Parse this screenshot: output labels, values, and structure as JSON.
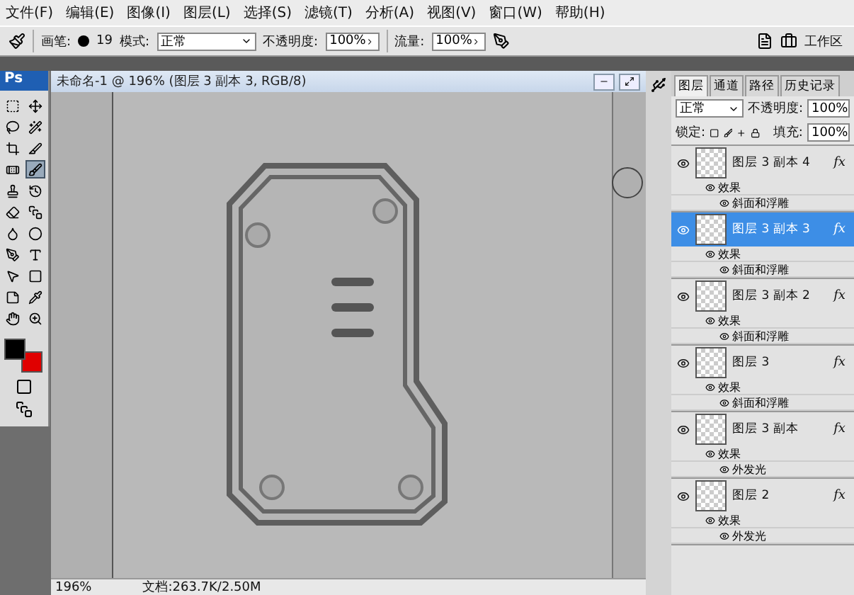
{
  "menu_bar": {
    "items": [
      "文件(F)",
      "编辑(E)",
      "图像(I)",
      "图层(L)",
      "选择(S)",
      "滤镜(T)",
      "分析(A)",
      "视图(V)",
      "窗口(W)",
      "帮助(H)"
    ]
  },
  "options_bar": {
    "brush_label": "画笔:",
    "brush_size": "19",
    "mode_label": "模式:",
    "mode": "正常",
    "opacity_label": "不透明度:",
    "opacity": "100%",
    "flow_label": "流量:",
    "flow": "100%",
    "workspace": "工作区"
  },
  "toolbox": {
    "logo": "Ps",
    "tools": [
      {
        "kind": "marquee",
        "selected": false
      },
      {
        "kind": "move",
        "selected": false
      },
      {
        "kind": "lasso",
        "selected": false
      },
      {
        "kind": "wand",
        "selected": false
      },
      {
        "kind": "crop",
        "selected": false
      },
      {
        "kind": "slice",
        "selected": false
      },
      {
        "kind": "heal",
        "selected": false
      },
      {
        "kind": "brush",
        "selected": true
      },
      {
        "kind": "stamp",
        "selected": false
      },
      {
        "kind": "history",
        "selected": false
      },
      {
        "kind": "eraser",
        "selected": false
      },
      {
        "kind": "gradient",
        "selected": false
      },
      {
        "kind": "blur",
        "selected": false
      },
      {
        "kind": "dodge",
        "selected": false
      },
      {
        "kind": "pen",
        "selected": false
      },
      {
        "kind": "type",
        "selected": false
      },
      {
        "kind": "select",
        "selected": false
      },
      {
        "kind": "shape",
        "selected": false
      },
      {
        "kind": "notes",
        "selected": false
      },
      {
        "kind": "eyedropper",
        "selected": false
      },
      {
        "kind": "hand",
        "selected": false
      },
      {
        "kind": "zoom",
        "selected": false
      }
    ]
  },
  "document": {
    "title": "未命名-1 @ 196% (图层 3 副本 3, RGB/8)",
    "zoom": "196%",
    "doc_info": "文档:263.7K/2.50M"
  },
  "layers_panel": {
    "tabs": [
      {
        "label": "图层",
        "selected": true
      },
      {
        "label": "通道",
        "selected": false
      },
      {
        "label": "路径",
        "selected": false
      },
      {
        "label": "历史记录",
        "selected": false
      }
    ],
    "blend_mode": "正常",
    "opacity_label": "不透明度:",
    "opacity": "100%",
    "lock_label": "锁定:",
    "fill_label": "填充:",
    "fill": "100%",
    "layers": [
      {
        "name": "图层 3 副本 4",
        "selected": false,
        "fx": "fx",
        "effects_label": "效果",
        "effect": "斜面和浮雕"
      },
      {
        "name": "图层 3 副本 3",
        "selected": true,
        "fx": "fx",
        "effects_label": "效果",
        "effect": "斜面和浮雕"
      },
      {
        "name": "图层 3 副本 2",
        "selected": false,
        "fx": "fx",
        "effects_label": "效果",
        "effect": "斜面和浮雕"
      },
      {
        "name": "图层 3",
        "selected": false,
        "fx": "fx",
        "effects_label": "效果",
        "effect": "斜面和浮雕"
      },
      {
        "name": "图层 3 副本",
        "selected": false,
        "fx": "fx",
        "effects_label": "效果",
        "effect": "外发光"
      },
      {
        "name": "图层 2",
        "selected": false,
        "fx": "fx",
        "effects_label": "效果",
        "effect": "外发光"
      }
    ]
  }
}
